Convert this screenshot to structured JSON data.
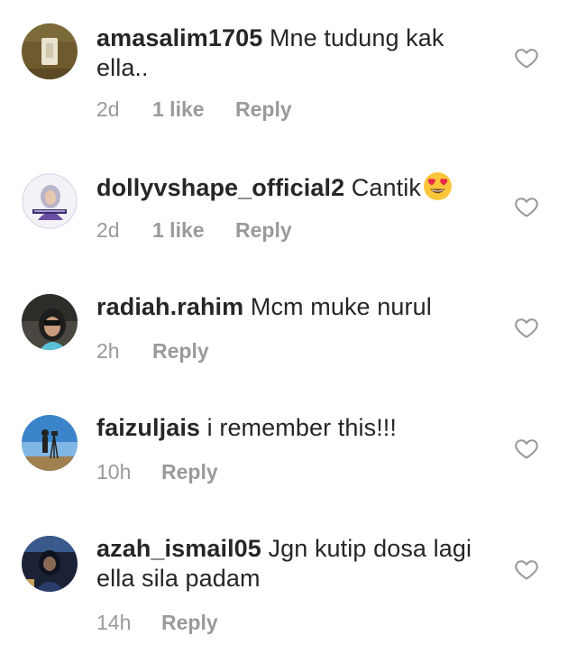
{
  "comments": [
    {
      "username": "amasalim1705",
      "text": " Mne tudung kak ella..",
      "time": "2d",
      "likes": "1 like",
      "reply": "Reply",
      "avatar_icon": "avatar-light-switch-photo"
    },
    {
      "username": "dollyvshape_official2",
      "text": " Cantik",
      "emoji": "heart-eyes-emoji",
      "time": "2d",
      "likes": "1 like",
      "reply": "Reply",
      "avatar_icon": "avatar-hijab-woman-photo"
    },
    {
      "username": "radiah.rahim",
      "text": " Mcm muke nurul",
      "time": "2h",
      "reply": "Reply",
      "avatar_icon": "avatar-car-selfie-photo"
    },
    {
      "username": "faizuljais",
      "text": " i remember this!!!",
      "time": "10h",
      "reply": "Reply",
      "avatar_icon": "avatar-photographer-sky-photo"
    },
    {
      "username": "azah_ismail05",
      "text": " Jgn kutip dosa lagi ella sila padam",
      "time": "14h",
      "reply": "Reply",
      "avatar_icon": "avatar-dark-portrait-photo"
    }
  ],
  "colors": {
    "text": "#262626",
    "meta": "#9a9a9a",
    "heart_outline": "#9a9a9a",
    "background": "#ffffff"
  }
}
